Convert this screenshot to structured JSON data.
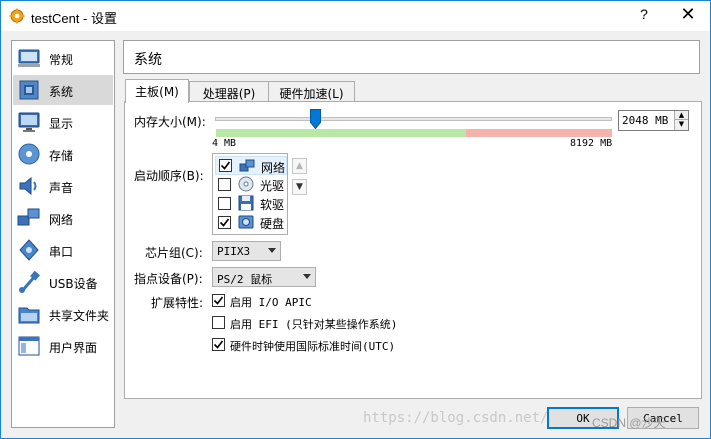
{
  "window": {
    "title": "testCent - 设置",
    "help_label": "?",
    "close_label": "✕"
  },
  "sidebar": {
    "items": [
      {
        "label": "常规",
        "icon": "general-icon"
      },
      {
        "label": "系统",
        "icon": "system-icon",
        "selected": true
      },
      {
        "label": "显示",
        "icon": "display-icon"
      },
      {
        "label": "存储",
        "icon": "storage-icon"
      },
      {
        "label": "声音",
        "icon": "audio-icon"
      },
      {
        "label": "网络",
        "icon": "network-icon"
      },
      {
        "label": "串口",
        "icon": "serial-port-icon"
      },
      {
        "label": "USB设备",
        "icon": "usb-icon"
      },
      {
        "label": "共享文件夹",
        "icon": "shared-folder-icon"
      },
      {
        "label": "用户界面",
        "icon": "user-interface-icon"
      }
    ]
  },
  "header": {
    "title": "系统"
  },
  "tabs": [
    {
      "label": "主板(M)",
      "active": true
    },
    {
      "label": "处理器(P)"
    },
    {
      "label": "硬件加速(L)"
    }
  ],
  "motherboard": {
    "memory": {
      "label": "内存大小(M):",
      "value": "2048 MB",
      "min_label": "4 MB",
      "max_label": "8192 MB",
      "fraction": 0.25
    },
    "boot_order": {
      "label": "启动顺序(B):",
      "items": [
        {
          "label": "网络",
          "checked": true,
          "icon": "network-boot-icon"
        },
        {
          "label": "光驱",
          "checked": false,
          "icon": "optical-drive-icon"
        },
        {
          "label": "软驱",
          "checked": false,
          "icon": "floppy-icon"
        },
        {
          "label": "硬盘",
          "checked": true,
          "icon": "hard-disk-icon"
        }
      ],
      "up_label": "▲",
      "down_label": "▼"
    },
    "chipset": {
      "label": "芯片组(C):",
      "value": "PIIX3"
    },
    "pointing": {
      "label": "指点设备(P):",
      "value": "PS/2 鼠标"
    },
    "features": {
      "label": "扩展特性:",
      "options": [
        {
          "label": "启用 I/O APIC",
          "checked": true
        },
        {
          "label": "启用 EFI (只针对某些操作系统)",
          "checked": false
        },
        {
          "label": "硬件时钟使用国际标准时间(UTC)",
          "checked": true
        }
      ]
    }
  },
  "buttons": {
    "ok": "OK",
    "cancel": "Cancel"
  },
  "watermark": {
    "url": "https://blog.csdn.net/qq_43",
    "badge": "CSDN @沙天"
  },
  "colors": {
    "accent": "#0078d7",
    "scale_green": "#b9e8a6",
    "scale_red": "#f5b3ad",
    "selected_bg": "#d9d9d9"
  }
}
